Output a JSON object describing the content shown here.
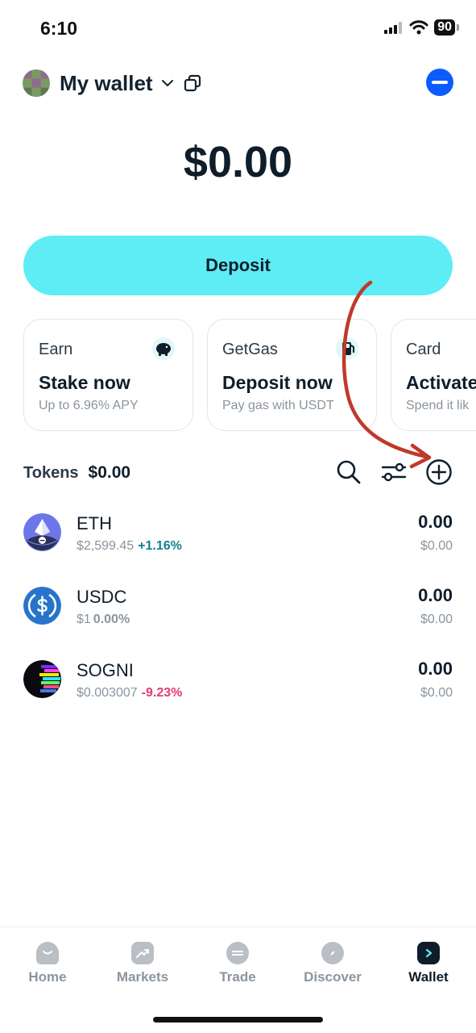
{
  "status_bar": {
    "time": "6:10",
    "battery": "90"
  },
  "header": {
    "title": "My wallet"
  },
  "balance": "$0.00",
  "deposit_label": "Deposit",
  "cards": [
    {
      "category": "Earn",
      "title": "Stake now",
      "subtitle": "Up to 6.96% APY",
      "icon": "piggy-bank-icon"
    },
    {
      "category": "GetGas",
      "title": "Deposit now",
      "subtitle": "Pay gas with USDT",
      "icon": "gas-pump-icon"
    },
    {
      "category": "Card",
      "title": "Activate",
      "subtitle": "Spend it lik",
      "icon": "card-icon"
    }
  ],
  "tokens": {
    "label": "Tokens",
    "total": "$0.00",
    "items": [
      {
        "symbol": "ETH",
        "price": "$2,599.45",
        "change": "+1.16%",
        "change_type": "pos",
        "amount": "0.00",
        "value": "$0.00"
      },
      {
        "symbol": "USDC",
        "price": "$1",
        "change": "0.00%",
        "change_type": "neu",
        "amount": "0.00",
        "value": "$0.00"
      },
      {
        "symbol": "SOGNI",
        "price": "$0.003007",
        "change": "-9.23%",
        "change_type": "neg",
        "amount": "0.00",
        "value": "$0.00"
      }
    ]
  },
  "nav": [
    "Home",
    "Markets",
    "Trade",
    "Discover",
    "Wallet"
  ],
  "colors": {
    "accent": "#5eecf5",
    "brand_blue": "#0a5cff",
    "positive": "#12818f",
    "negative": "#e43a6f",
    "annotation_arrow": "#c0392b"
  }
}
